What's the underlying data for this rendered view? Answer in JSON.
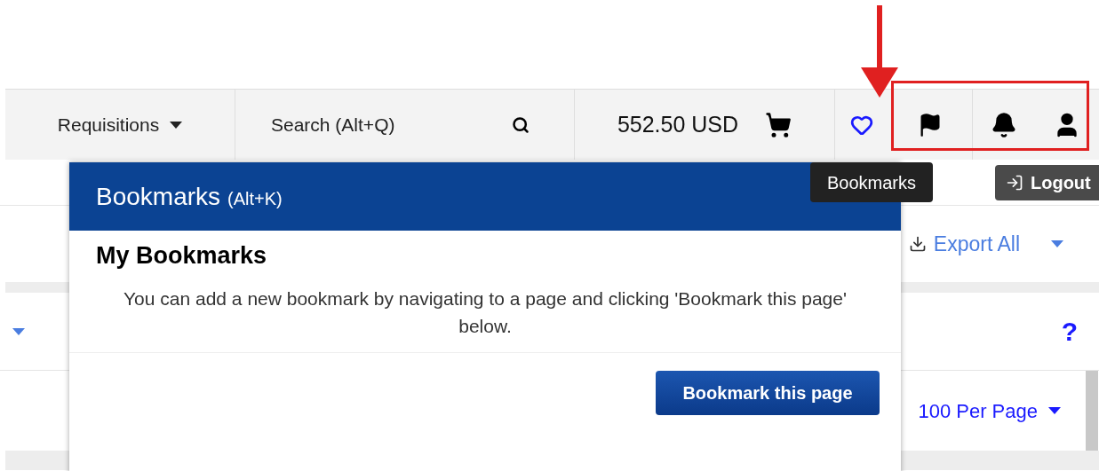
{
  "nav": {
    "menu": "Requisitions",
    "search": {
      "placeholder": "Search (Alt+Q)"
    },
    "cart_total": "552.50 USD"
  },
  "tooltip": "Bookmarks",
  "logout": "Logout",
  "page": {
    "export": "Export All",
    "help": "?",
    "per_page": "100 Per Page"
  },
  "popup": {
    "title": "Bookmarks",
    "shortcut": "(Alt+K)",
    "heading": "My Bookmarks",
    "message": "You can add a new bookmark by navigating to a page and clicking 'Bookmark this page' below.",
    "button": "Bookmark this page"
  }
}
